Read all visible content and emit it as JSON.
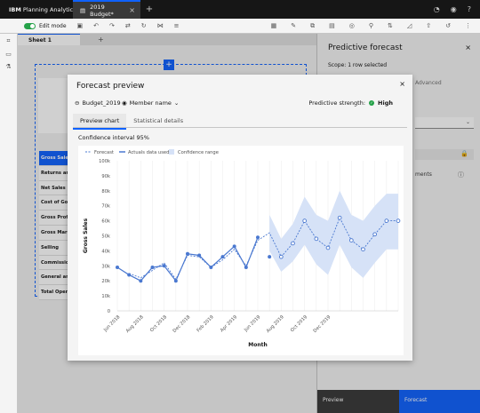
{
  "app": {
    "brand": "IBM",
    "product": "Planning Analytics",
    "tab_title": "2019 Budget*",
    "tab_close": "×",
    "tab_add": "+"
  },
  "toolbar": {
    "edit_mode_label": "Edit mode"
  },
  "sheet": {
    "tab_label": "Sheet 1",
    "add": "+"
  },
  "canvas": {
    "plus": "+",
    "rows": [
      "Gross Sales",
      "Returns and...",
      "Net Sales",
      "Cost of Goods...",
      "Gross Profit",
      "Gross Margin",
      "Selling",
      "Commissions",
      "General and...",
      "Total Oper..."
    ]
  },
  "panel": {
    "title": "Predictive forecast",
    "close": "×",
    "scope": "Scope: 1 row selected",
    "advanced": "Advanced",
    "ents": "ments",
    "preview_btn": "Preview",
    "forecast_btn": "Forecast"
  },
  "modal": {
    "title": "Forecast preview",
    "close": "×",
    "dim1": "Budget_2019",
    "dim2": "Member name",
    "strength_label": "Predictive strength:",
    "strength_value": "High",
    "tabs": [
      "Preview chart",
      "Statistical details"
    ],
    "confidence": "Confidence interval 95%"
  },
  "colors": {
    "accent": "#0f62fe",
    "series": "#4a78d0",
    "band": "#d6e2f7",
    "success": "#24a148"
  },
  "chart_data": {
    "type": "line",
    "xlabel": "Month",
    "ylabel": "Gross Sales",
    "ylim": [
      0,
      100000
    ],
    "yticks": [
      "0",
      "10k",
      "20k",
      "30k",
      "40k",
      "50k",
      "60k",
      "70k",
      "80k",
      "90k",
      "100k"
    ],
    "xtick_labels": [
      "Jun 2018",
      "Aug 2018",
      "Oct 2018",
      "Dec 2018",
      "Feb 2019",
      "Apr 2019",
      "Jun 2019",
      "Aug 2019",
      "Oct 2019",
      "Dec 2019"
    ],
    "legend": [
      "Forecast",
      "Actuals data used",
      "Confidence range"
    ],
    "series": [
      {
        "name": "Actuals data used",
        "x": [
          "2018-06",
          "2018-07",
          "2018-08",
          "2018-09",
          "2018-10",
          "2018-11",
          "2018-12",
          "2019-01",
          "2019-02",
          "2019-03",
          "2019-04",
          "2019-05",
          "2019-06"
        ],
        "values": [
          29000,
          24000,
          20000,
          29000,
          30000,
          20000,
          38000,
          37000,
          29000,
          36000,
          43000,
          29000,
          49000
        ]
      },
      {
        "name": "Forecast",
        "x": [
          "2018-07",
          "2018-08",
          "2018-09",
          "2018-10",
          "2018-11",
          "2018-12",
          "2019-01",
          "2019-02",
          "2019-03",
          "2019-04",
          "2019-05",
          "2019-06",
          "2019-07",
          "2019-08",
          "2019-09",
          "2019-10",
          "2019-11",
          "2019-12",
          "2020-01",
          "2020-02",
          "2020-03",
          "2020-04",
          "2020-05",
          "2020-06"
        ],
        "values": [
          25000,
          22000,
          27000,
          32000,
          21000,
          37000,
          36000,
          29000,
          34000,
          41000,
          30000,
          47000,
          52000,
          36000,
          45000,
          60000,
          48000,
          42000,
          62000,
          47000,
          41000,
          51000,
          60000,
          60000
        ]
      },
      {
        "name": "Confidence range",
        "x": [
          "2019-07",
          "2019-08",
          "2019-09",
          "2019-10",
          "2019-11",
          "2019-12",
          "2020-01",
          "2020-02",
          "2020-03",
          "2020-04",
          "2020-05",
          "2020-06"
        ],
        "lower": [
          40000,
          26000,
          33000,
          44000,
          31000,
          24000,
          44000,
          29000,
          22000,
          32000,
          41000,
          41000
        ],
        "upper": [
          64000,
          48000,
          58000,
          76000,
          64000,
          60000,
          80000,
          64000,
          60000,
          70000,
          78000,
          78000
        ]
      }
    ],
    "grid": "vertical"
  }
}
